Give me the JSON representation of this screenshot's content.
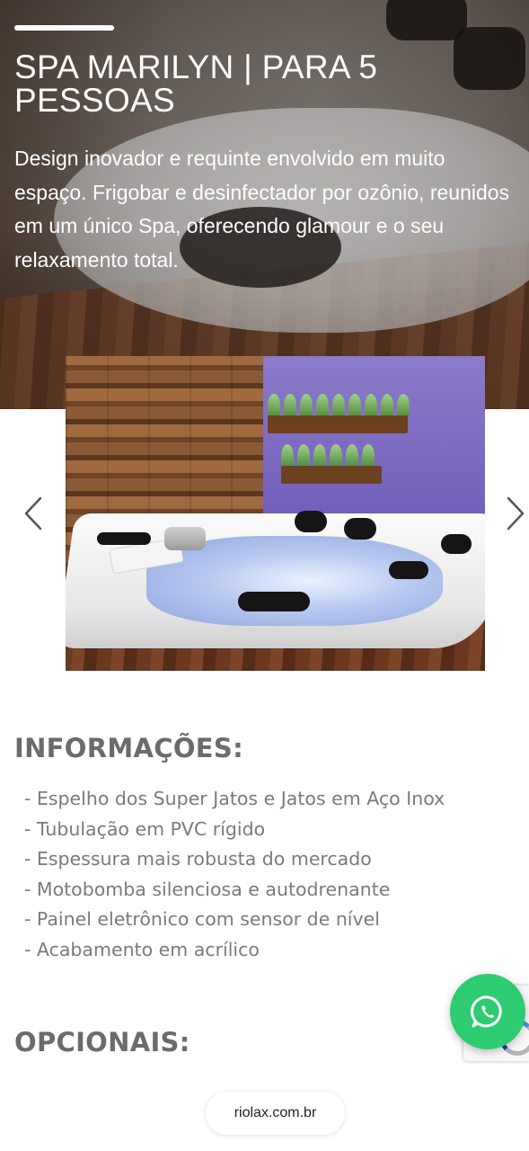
{
  "hero": {
    "title": "SPA MARILYN | PARA 5 PESSOAS",
    "description": "Design inovador e requinte envolvido em muito espaço. Frigobar e desinfectador por ozônio, reunidos em um único Spa, oferecendo glamour e o seu relaxamento total."
  },
  "carousel": {
    "prev_icon": "chevron-left-icon",
    "next_icon": "chevron-right-icon"
  },
  "info": {
    "heading": "INFORMAÇÕES:",
    "items": [
      "- Espelho dos Super Jatos e Jatos em Aço Inox",
      "- Tubulação em PVC rígido",
      "- Espessura mais robusta do mercado",
      "- Motobomba silenciosa e autodrenante",
      "- Painel eletrônico com sensor de nível",
      "- Acabamento em acrílico"
    ]
  },
  "optional": {
    "heading": "OPCIONAIS:"
  },
  "browser": {
    "url": "riolax.com.br"
  },
  "fab": {
    "icon": "whatsapp-icon",
    "color": "#2ecc71"
  }
}
